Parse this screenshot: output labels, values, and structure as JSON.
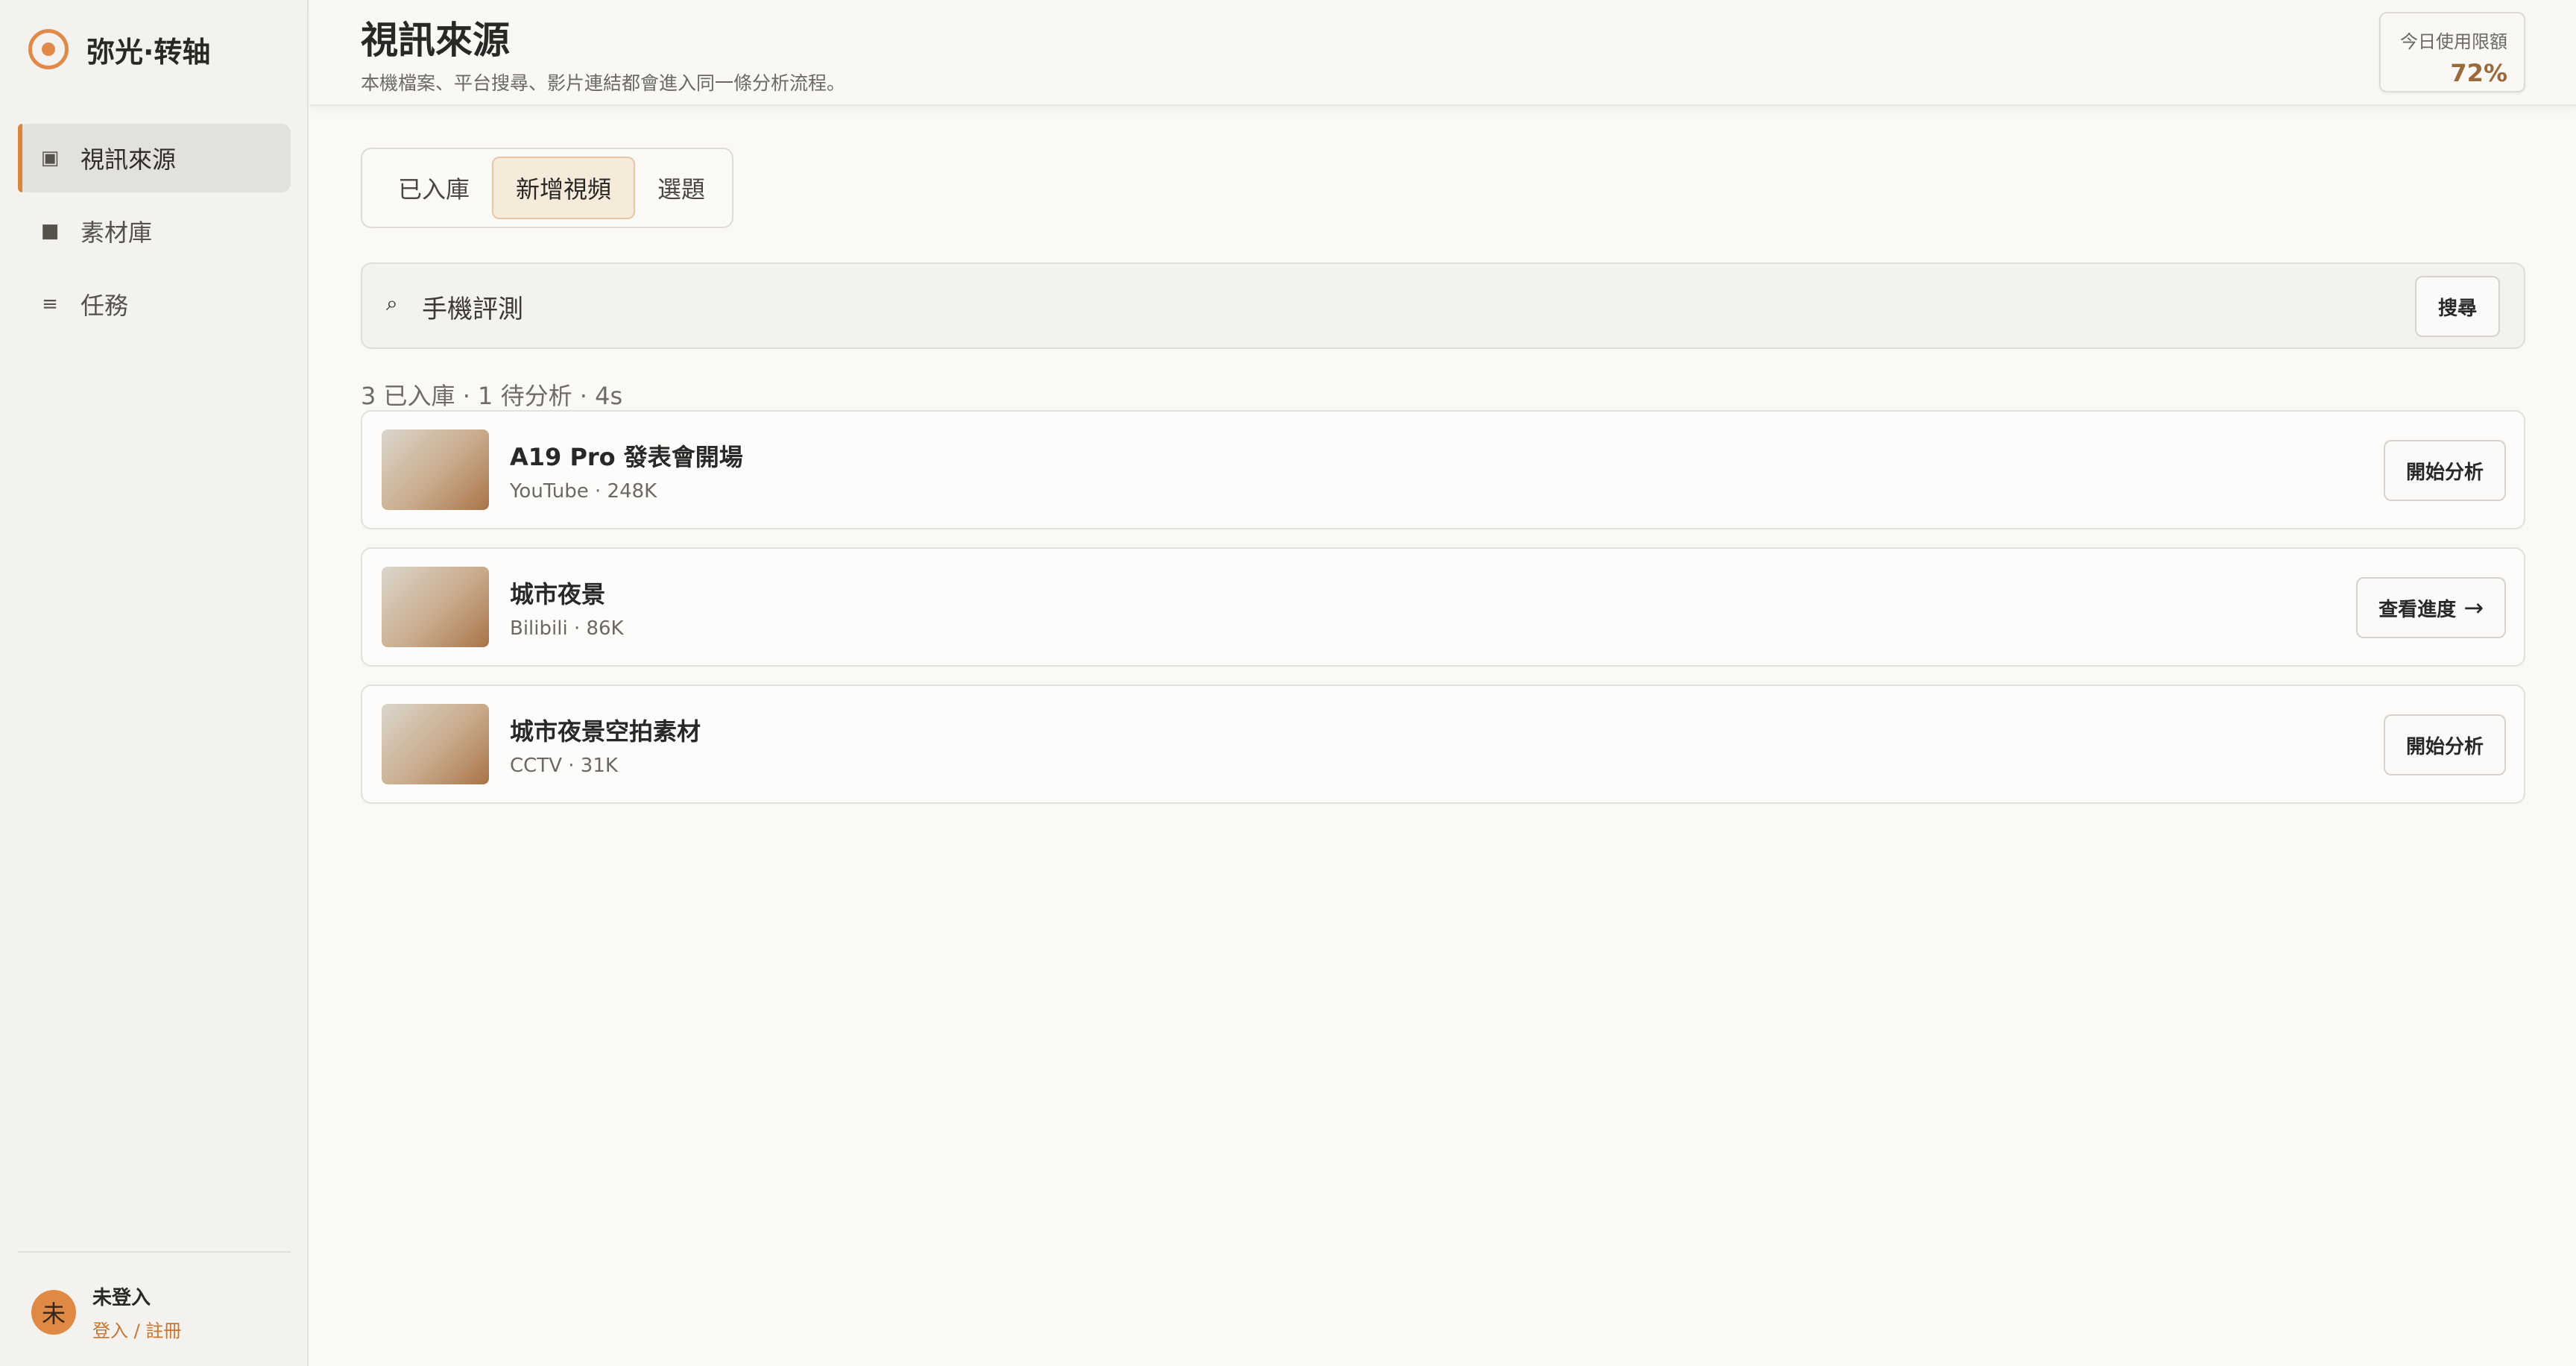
{
  "app": {
    "name": "弥光·转轴"
  },
  "sidebar": {
    "items": [
      {
        "label": "視訊來源",
        "icon": "square-outline-icon",
        "active": true
      },
      {
        "label": "素材庫",
        "icon": "square-filled-icon",
        "active": false
      },
      {
        "label": "任務",
        "icon": "list-icon",
        "active": false
      }
    ]
  },
  "user": {
    "avatar_text": "未",
    "status": "未登入",
    "login_link": "登入 / 註冊"
  },
  "header": {
    "title": "視訊來源",
    "subtitle": "本機檔案、平台搜尋、影片連結都會進入同一條分析流程。",
    "quota_label": "今日使用限額",
    "quota_value": "72%"
  },
  "tabs": [
    {
      "label": "已入庫",
      "active": false
    },
    {
      "label": "新增視頻",
      "active": true
    },
    {
      "label": "選題",
      "active": false
    }
  ],
  "search": {
    "value": "手機評測",
    "button": "搜尋"
  },
  "stats": "3 已入庫 · 1 待分析 · 4s",
  "videos": [
    {
      "title": "A19 Pro 發表會開場",
      "meta": "YouTube · 248K",
      "action": "開始分析"
    },
    {
      "title": "城市夜景",
      "meta": "Bilibili · 86K",
      "action": "查看進度",
      "action_icon": "→"
    },
    {
      "title": "城市夜景空拍素材",
      "meta": "CCTV · 31K",
      "action": "開始分析"
    }
  ],
  "colors": {
    "accent": "#d7863f",
    "quota": "#9a6a3c",
    "link": "#c8742f"
  }
}
